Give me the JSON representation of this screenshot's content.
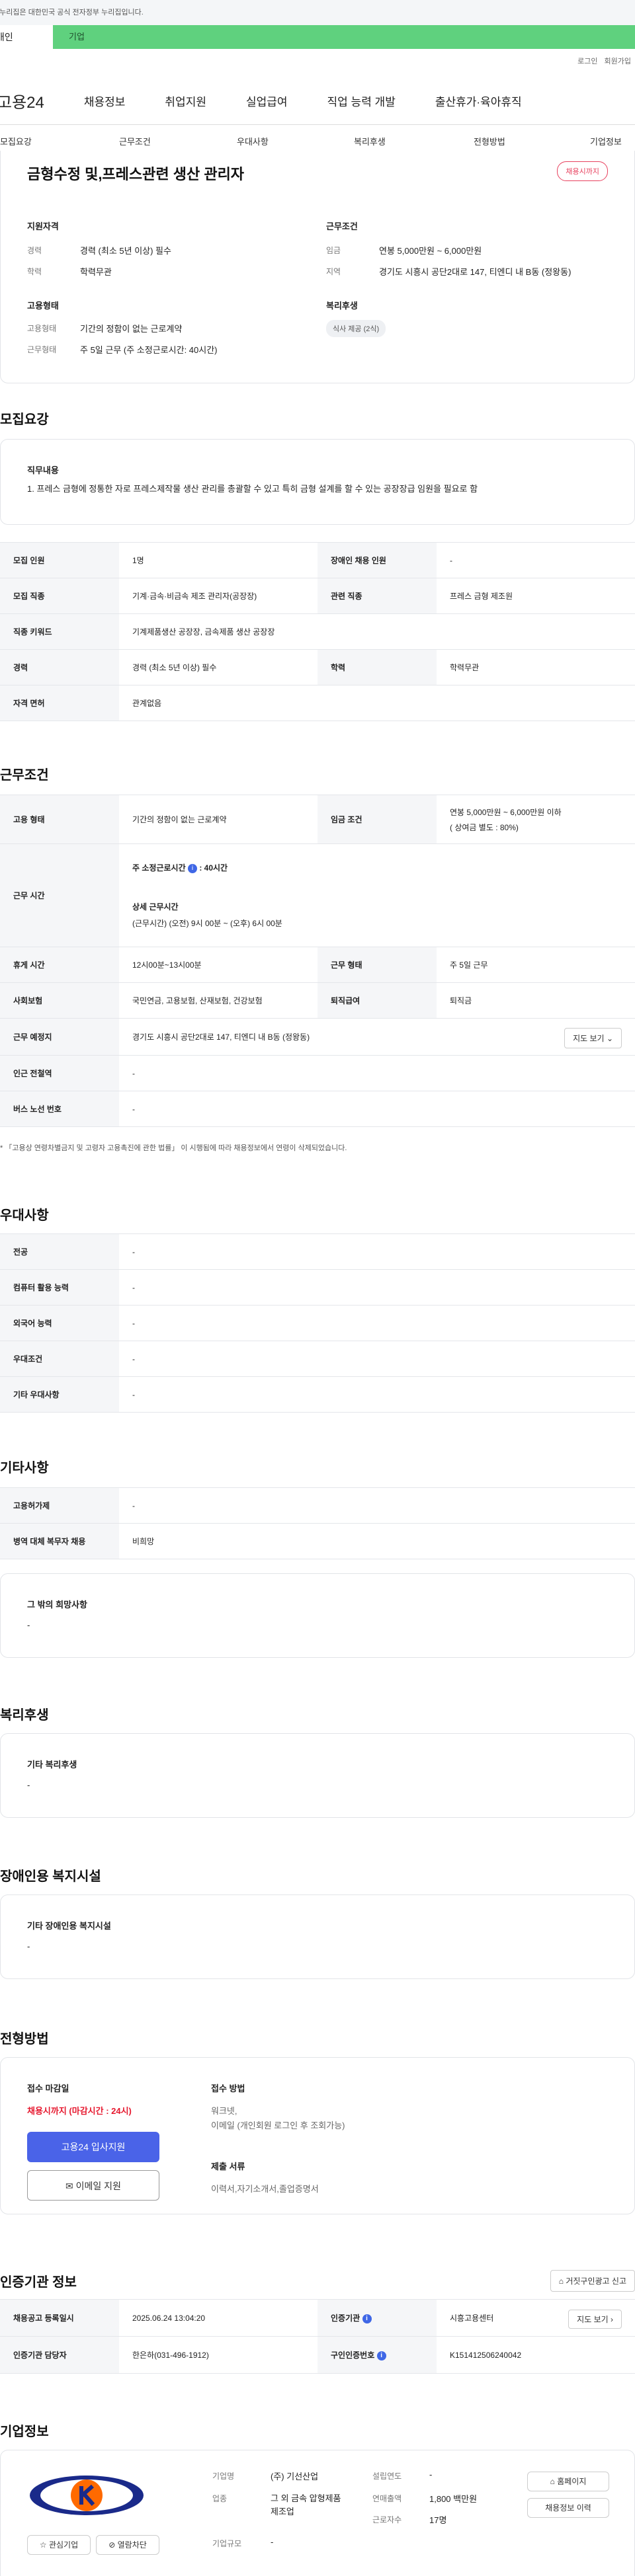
{
  "gov_banner": "이 누리집은 대한민국 공식 전자정부 누리집입니다.",
  "top_tabs": {
    "individual": "개인",
    "company": "기업"
  },
  "util": {
    "login": "로그인",
    "join": "회원가입"
  },
  "logo": "고용24",
  "gnb": [
    "채용정보",
    "취업지원",
    "실업급여",
    "직업 능력 개발",
    "출산휴가·육아휴직"
  ],
  "subnav": [
    "모집요강",
    "근무조건",
    "우대사항",
    "복리후생",
    "전형방법",
    "기업정보"
  ],
  "job": {
    "title": "금형수정 및,프레스관련 생산 관리자",
    "status": "채용시까지",
    "qual": {
      "heading": "지원자격",
      "career_label": "경력",
      "career_value": "경력 (최소 5년 이상) 필수",
      "edu_label": "학력",
      "edu_value": "학력무관"
    },
    "cond": {
      "heading": "근무조건",
      "wage_label": "임금",
      "wage_value": "연봉 5,000만원 ~ 6,000만원",
      "area_label": "지역",
      "area_value": "경기도 시흥시 공단2대로 147, 티엔디 내 B동 (정왕동)"
    },
    "emp": {
      "heading": "고용형태",
      "type_label": "고용형태",
      "type_value": "기간의 정함이 없는 근로계약",
      "form_label": "근무형태",
      "form_value": "주 5일 근무 (주 소정근로시간: 40시간)"
    },
    "welfare": {
      "heading": "복리후생",
      "chip": "식사 제공 (2식)"
    }
  },
  "recruit": {
    "heading": "모집요강",
    "duty_heading": "직무내용",
    "duty_text": "1. 프레스 금형에 정통한 자로  프레스제작물 생산 관리를 총괄할 수 있고 특히 금형 설계를 할 수 있는  공장장급 임원을 필요로 함",
    "rows": [
      {
        "k1": "모집 인원",
        "v1": "1명",
        "k2": "장애인 채용 인원",
        "v2": "-"
      },
      {
        "k1": "모집 직종",
        "v1": "기계·금속·비금속 제조 관리자(공장장)",
        "k2": "관련 직종",
        "v2": "프레스 금형 제조원"
      },
      {
        "k1": "직종 키워드",
        "v1": "기계제품생산 공장장, 금속제품 생산 공장장"
      },
      {
        "k1": "경력",
        "v1": "경력 (최소 5년 이상) 필수",
        "k2": "학력",
        "v2": "학력무관"
      },
      {
        "k1": "자격 면허",
        "v1": "관계없음"
      }
    ]
  },
  "work": {
    "heading": "근무조건",
    "emp_type_k": "고용 형태",
    "emp_type_v": "기간의 정함이 없는 근로계약",
    "wage_k": "임금 조건",
    "wage_v": "연봉 5,000만원 ~ 6,000만원 이하",
    "wage_sub": "( 상여금 별도 : 80%)",
    "hours_k": "근무 시간",
    "hours_week_label": "주 소정근로시간",
    "hours_week_val": ": 40시간",
    "hours_detail_label": "상세 근무시간",
    "hours_detail_val": "(근무시간) (오전) 9시 00분 ~ (오후) 6시 00분",
    "break_k": "휴게 시간",
    "break_v": "12시00분~13시00분",
    "form_k": "근무 형태",
    "form_v": "주 5일 근무",
    "ins_k": "사회보험",
    "ins_v": "국민연금, 고용보험, 산재보험, 건강보험",
    "sev_k": "퇴직급여",
    "sev_v": "퇴직금",
    "place_k": "근무 예정지",
    "place_v": "경기도 시흥시 공단2대로 147, 티엔디 내 B동 (정왕동)",
    "map_btn": "지도 보기",
    "subway_k": "인근 전철역",
    "subway_v": "-",
    "bus_k": "버스 노선 번호",
    "bus_v": "-",
    "note": "「고용상 연령차별금지 및 고령자 고용촉진에 관한 법률」 이 시행됨에 따라 채용정보에서 연령이 삭제되었습니다."
  },
  "pref": {
    "heading": "우대사항",
    "rows": [
      {
        "k": "전공",
        "v": "-"
      },
      {
        "k": "컴퓨터 활용 능력",
        "v": "-"
      },
      {
        "k": "외국어 능력",
        "v": "-"
      },
      {
        "k": "우대조건",
        "v": "-"
      },
      {
        "k": "기타 우대사항",
        "v": "-"
      }
    ]
  },
  "etc": {
    "heading": "기타사항",
    "rows": [
      {
        "k": "고용허가제",
        "v": "-"
      },
      {
        "k": "병역 대체 복무자 채용",
        "v": "비희망"
      }
    ],
    "other_heading": "그 밖의 희망사항",
    "other_val": "-"
  },
  "welfare2": {
    "heading": "복리후생",
    "sub": "기타 복리후생",
    "val": "-"
  },
  "disabled": {
    "heading": "장애인용 복지시설",
    "sub": "기타 장애인용 복지시설",
    "val": "-"
  },
  "selection": {
    "heading": "전형방법",
    "deadline_label": "접수 마감일",
    "deadline_value": "채용시까지 (마감시간 : 24시)",
    "apply_btn": "고용24 입사지원",
    "email_btn": "이메일 지원",
    "method_label": "접수 방법",
    "method_value": "워크넷,",
    "method_value2": "이메일 (개인회원 로그인 후 조회가능)",
    "docs_label": "제출 서류",
    "docs_value": "이력서,자기소개서,졸업증명서"
  },
  "cert": {
    "heading": "인증기관 정보",
    "report_btn": "거짓구인광고 신고",
    "reg_k": "채용공고 등록일시",
    "reg_v": "2025.06.24 13:04:20",
    "org_k": "인증기관",
    "org_v": "시흥고용센터",
    "map_btn": "지도 보기",
    "mgr_k": "인증기관 담당자",
    "mgr_v": "한은하(031-496-1912)",
    "num_k": "구인인증번호",
    "num_v": "K151412506240042"
  },
  "company": {
    "heading": "기업정보",
    "name_k": "기업명",
    "name_v": "(주) 기선산업",
    "year_k": "설립연도",
    "year_v": "-",
    "ind_k": "업종",
    "ind_v": "그 외 금속 압형제품 제조업",
    "sales_k": "연매출액",
    "sales_v": "1,800 백만원",
    "emp_k": "근로자수",
    "emp_v": "17명",
    "size_k": "기업규모",
    "size_v": "-",
    "home_btn": "홈페이지",
    "hist_btn": "채용정보 이력",
    "fav_btn": "관심기업",
    "block_btn": "열람차단"
  },
  "colors": {
    "accent_green": "#5fd17e",
    "status_red": "#e8425f",
    "primary_blue": "#4a63e8"
  }
}
